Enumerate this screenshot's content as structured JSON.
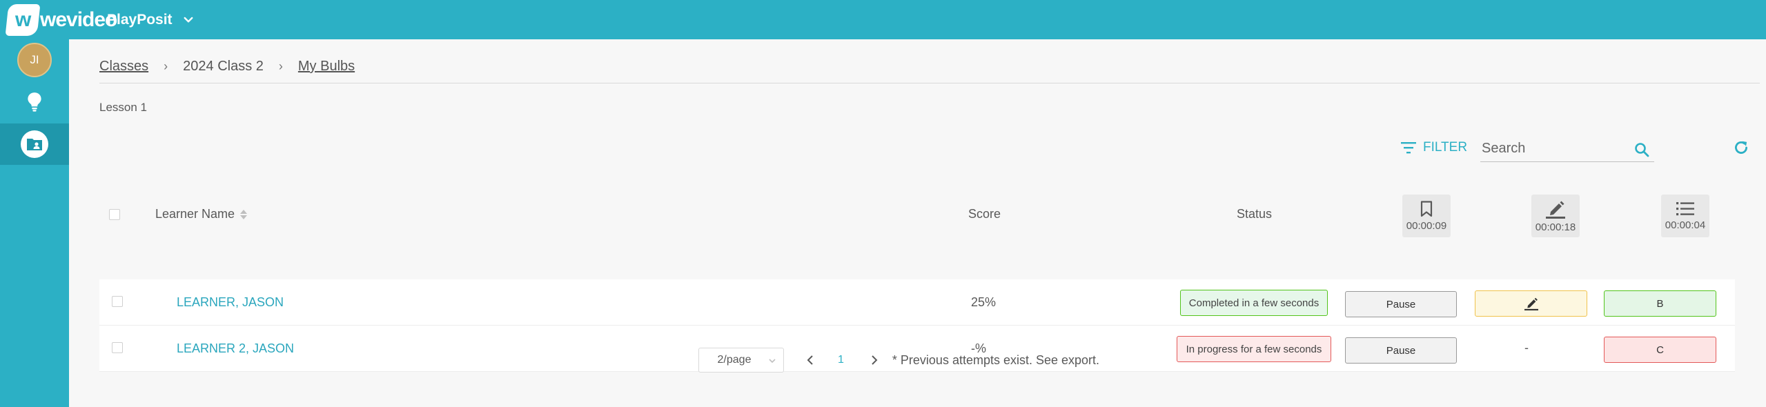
{
  "header": {
    "logo_text": "wevideo",
    "app_name": "PlayPosit",
    "brand_color": "#2cb0c5"
  },
  "sidebar": {
    "avatar_initials": "JI",
    "items": [
      {
        "icon": "lightbulb-icon"
      },
      {
        "icon": "folder-user-icon",
        "active": true
      }
    ]
  },
  "breadcrumb": {
    "items": [
      "Classes",
      "2024 Class 2",
      "My Bulbs"
    ],
    "separator": "›"
  },
  "lesson_title": "Lesson 1",
  "toolbar": {
    "filter_label": "FILTER",
    "search_placeholder": "Search"
  },
  "table": {
    "columns": {
      "name": "Learner Name",
      "score": "Score",
      "status": "Status"
    },
    "question_columns": [
      {
        "icon": "bookmark-icon",
        "time": "00:00:09"
      },
      {
        "icon": "pencil-icon",
        "time": "00:00:18"
      },
      {
        "icon": "list-icon",
        "time": "00:00:04"
      }
    ],
    "rows": [
      {
        "name": "LEARNER, JASON",
        "score": "25%",
        "status": "Completed in a few seconds",
        "status_type": "done",
        "q1": "Pause",
        "q2_type": "edit",
        "q3": "B",
        "q3_type": "correct"
      },
      {
        "name": "LEARNER 2, JASON",
        "score": "-%",
        "status": "In progress for a few seconds",
        "status_type": "progress",
        "q1": "Pause",
        "q2": "-",
        "q3": "C",
        "q3_type": "incorrect"
      }
    ]
  },
  "pagination": {
    "page_size": "2/page",
    "current_page": "1",
    "note": "* Previous attempts exist. See export."
  }
}
